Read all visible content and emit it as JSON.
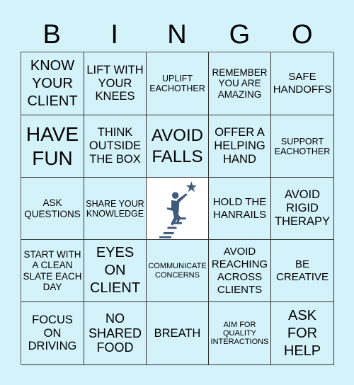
{
  "header": {
    "letters": [
      "B",
      "I",
      "N",
      "G",
      "O"
    ]
  },
  "colors": {
    "background": "#d4f2fa",
    "free_space_background": "#ffffff",
    "logo_color": "#3f5a7d",
    "grid_line": "#333333"
  },
  "board": {
    "rows": [
      [
        "KNOW YOUR CLIENT",
        "LIFT WITH YOUR KNEES",
        "UPLIFT EACHOTHER",
        "REMEMBER YOU ARE AMAZING",
        "SAFE HANDOFFS"
      ],
      [
        "HAVE FUN",
        "THINK OUTSIDE THE BOX",
        "AVOID FALLS",
        "OFFER A HELPING HAND",
        "SUPPORT EACHOTHER"
      ],
      [
        "ASK QUESTIONS",
        "SHARE YOUR KNOWLEDGE",
        "",
        "HOLD THE HANRAILS",
        "AVOID RIGID THERAPY"
      ],
      [
        "START WITH A CLEAN SLATE EACH DAY",
        "EYES ON CLIENT",
        "COMMUNICATE CONCERNS",
        "AVOID REACHING ACROSS CLIENTS",
        "BE CREATIVE"
      ],
      [
        "FOCUS ON DRIVING",
        "NO SHARED FOOD",
        "BREATH",
        "AIM FOR QUALITY INTERACTIONS",
        "ASK FOR HELP"
      ]
    ],
    "free_space_icon": "person-climbing-stairs-to-star-icon"
  }
}
